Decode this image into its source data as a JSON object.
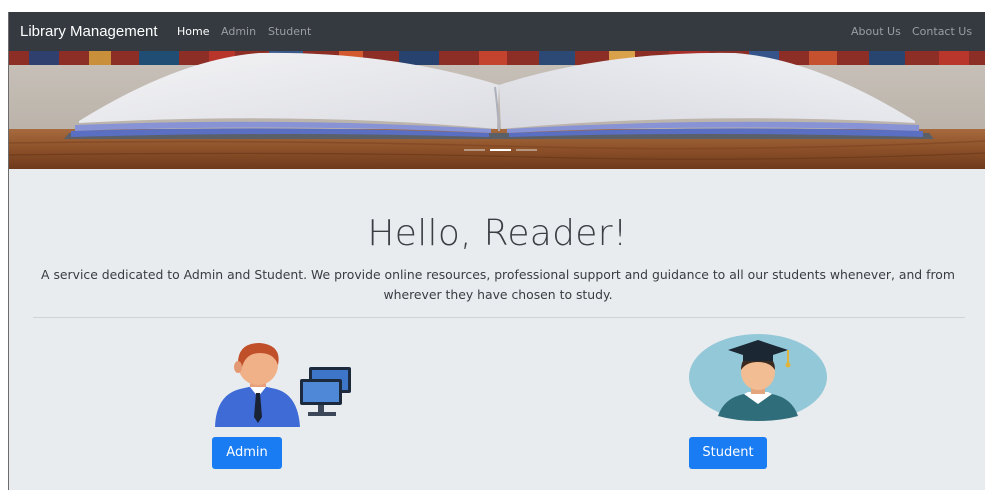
{
  "navbar": {
    "brand": "Library Management",
    "left_links": [
      {
        "label": "Home",
        "active": true
      },
      {
        "label": "Admin",
        "active": false
      },
      {
        "label": "Student",
        "active": false
      }
    ],
    "right_links": [
      {
        "label": "About Us"
      },
      {
        "label": "Contact Us"
      }
    ]
  },
  "carousel": {
    "slide_count": 3,
    "active_slide": 2
  },
  "hero": {
    "title": "Hello, Reader!",
    "lead": "A service dedicated to Admin and Student. We provide online resources, professional support and guidance to all our students whenever, and from wherever they have chosen to study."
  },
  "roles": {
    "admin": {
      "icon": "admin-computer-icon",
      "button_label": "Admin"
    },
    "student": {
      "icon": "graduate-student-icon",
      "button_label": "Student"
    }
  },
  "colors": {
    "navbar_bg": "#343a40",
    "page_bg": "#e9ecef",
    "primary": "#1a7cf2"
  }
}
